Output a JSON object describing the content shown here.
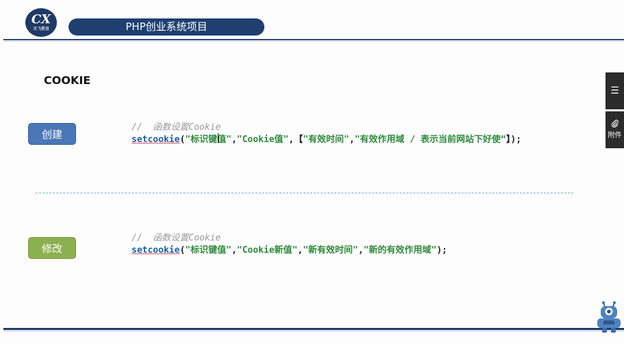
{
  "header": {
    "logo_mark": "CX",
    "logo_sub": "讯飞教育",
    "title": "PHP创业系统项目"
  },
  "main": {
    "heading": "COOKIE",
    "sections": [
      {
        "button_label": "创建",
        "comment": "//  函数设置Cookie",
        "code": {
          "fn": "setcookie",
          "open": "(",
          "arg1": "\"标识键值\"",
          "sep1": ",",
          "arg2": "\"Cookie值\"",
          "sep2": ",",
          "bracket_open": "【",
          "arg3": "\"有效时间\"",
          "sep3": ",",
          "arg4": "\"有效作用域 / 表示当前网站下好使“",
          "bracket_close": "】",
          "close": ");"
        }
      },
      {
        "button_label": "修改",
        "comment": "//  函数设置Cookie",
        "code": {
          "fn": "setcookie",
          "open": "(",
          "arg1": "\"标识键值\"",
          "sep1": ",",
          "arg2": "\"Cookie新值\"",
          "sep2": ",",
          "arg3": "\"新有效时间\"",
          "sep3": ",",
          "arg4": "\"新的有效作用域\"",
          "close": ");"
        }
      }
    ]
  },
  "side_panel": {
    "tabs": [
      {
        "icon": "list-icon",
        "label": ""
      },
      {
        "icon": "paperclip-icon",
        "label": "附件"
      }
    ]
  },
  "colors": {
    "brand_navy": "#1e3f70",
    "create_blue": "#4a77b6",
    "modify_green": "#8cb050",
    "string_green": "#2f8a3c",
    "function_blue": "#1e5fa8"
  }
}
